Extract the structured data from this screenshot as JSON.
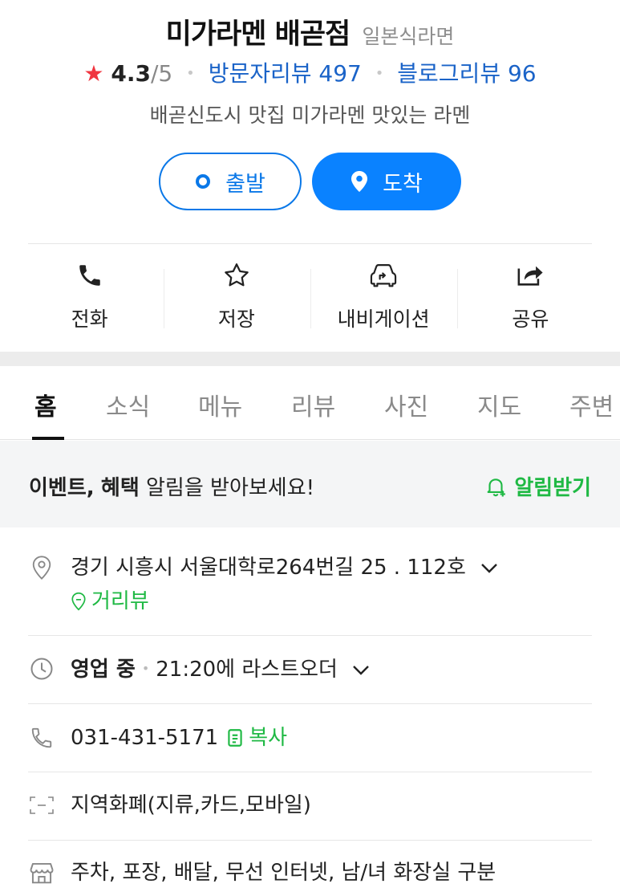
{
  "place": {
    "name": "미가라멘 배곧점",
    "category": "일본식라면",
    "rating": "4.3",
    "rating_max": "/5",
    "visitor_reviews": "방문자리뷰 497",
    "blog_reviews": "블로그리뷰 96",
    "description": "배곧신도시 맛집 미가라멘 맛있는 라멘"
  },
  "route": {
    "depart_label": "출발",
    "arrive_label": "도착"
  },
  "actions": {
    "call": "전화",
    "save": "저장",
    "navigation": "내비게이션",
    "share": "공유"
  },
  "tabs": [
    "홈",
    "소식",
    "메뉴",
    "리뷰",
    "사진",
    "지도",
    "주변"
  ],
  "notice": {
    "bold1": "이벤트,",
    "bold2": "혜택",
    "rest": "알림을 받아보세요!",
    "button": "알림받기"
  },
  "info": {
    "address": "경기 시흥시 서울대학로264번길 25 . 112호",
    "street_view": "거리뷰",
    "status": "영업 중",
    "last_order": "21:20에 라스트오더",
    "phone": "031-431-5171",
    "copy": "복사",
    "payment": "지역화폐(지류,카드,모바일)",
    "amenities": "주차, 포장, 배달, 무선 인터넷, 남/녀 화장실 구분"
  },
  "colors": {
    "accent_blue": "#0a82ff",
    "link_blue": "#1a63c8",
    "star_red": "#f0353f",
    "green": "#1fb944"
  }
}
